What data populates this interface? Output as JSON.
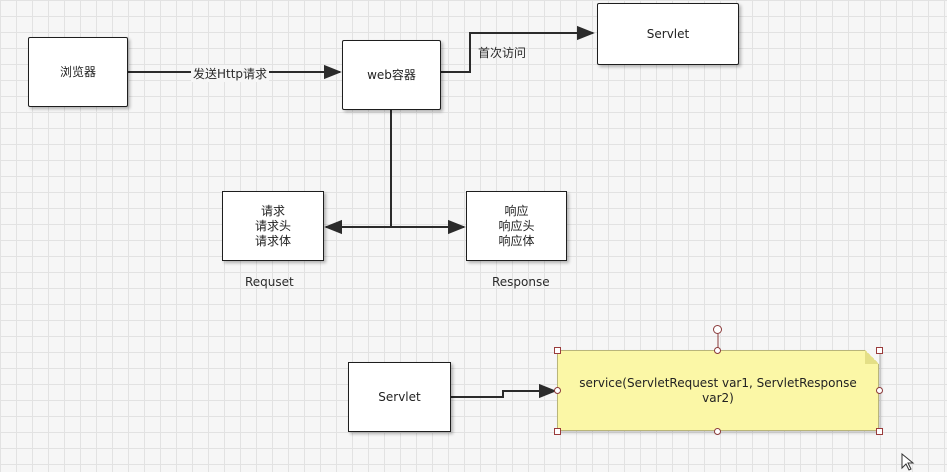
{
  "nodes": {
    "browser": "浏览器",
    "web_container": "web容器",
    "servlet_top": "Servlet",
    "request_box": [
      "请求",
      "请求头",
      "请求体"
    ],
    "response_box": [
      "响应",
      "响应头",
      "响应体"
    ],
    "servlet_bottom": "Servlet",
    "service_note": "service(ServletRequest var1, ServletResponse var2)"
  },
  "edge_labels": {
    "send_http_request": "发送Http请求",
    "first_visit": "首次访问"
  },
  "captions": {
    "request": "Requset",
    "response": "Response"
  },
  "colors": {
    "line": "#2b2b2b",
    "note_fill": "#fbf7a6",
    "handle_border": "#9a3b3b"
  }
}
